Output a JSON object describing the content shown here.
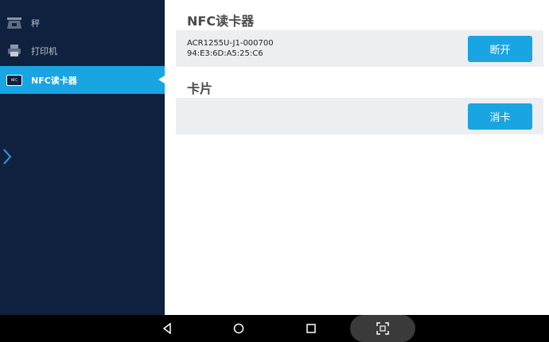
{
  "sidebar": {
    "items": [
      {
        "label": "秤",
        "icon": "scale-icon",
        "active": false
      },
      {
        "label": "打印机",
        "icon": "printer-icon",
        "active": false
      },
      {
        "label": "NFC读卡器",
        "icon": "nfc-reader-icon",
        "icon_text": "NFC",
        "active": true
      }
    ]
  },
  "nfc_section": {
    "title": "NFC读卡器",
    "device_name": "ACR1255U-J1-000700",
    "device_address": "94:E3:6D:A5:25:C6",
    "disconnect_label": "断开"
  },
  "card_section": {
    "title": "卡片",
    "cancel_card_label": "消卡"
  },
  "navbar": {
    "buttons": [
      "back-icon",
      "home-icon",
      "recents-icon",
      "screenshot-icon"
    ]
  },
  "colors": {
    "sidebar_bg": "#10213f",
    "accent": "#19a4e2",
    "panel_bg": "#eceef2"
  }
}
